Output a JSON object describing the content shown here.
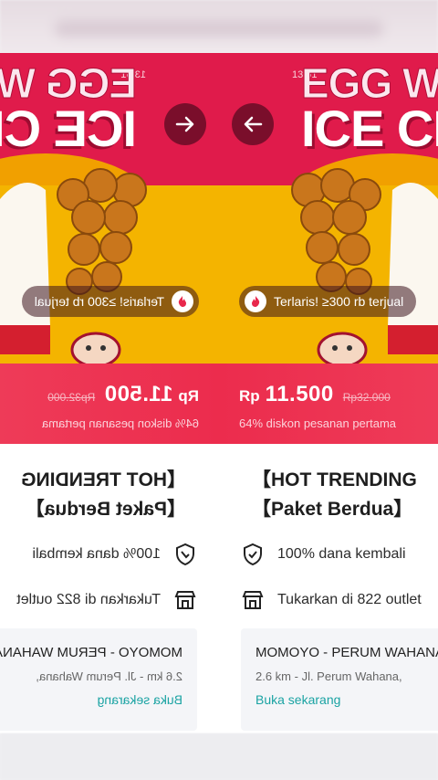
{
  "status": {
    "time": "13:51"
  },
  "hero": {
    "title_line1": "EGG WA",
    "title_line2": "ICE CR",
    "badge": "Terlaris! ≥300 rb terjual"
  },
  "price": {
    "currency": "Rp",
    "amount": "11.500",
    "original": "Rp32.000",
    "discount": "64% diskon pesanan pertama"
  },
  "product": {
    "title_line1": "【HOT TRENDING",
    "title_line2": "【Paket Berdua】",
    "feature1": "100% dana kembali",
    "feature2": "Tukarkan di 822 outlet"
  },
  "store": {
    "name": "MOMOYO - PERUM WAHANA",
    "address": "2.6 km - Jl. Perum Wahana,",
    "action": "Buka sekarang"
  },
  "nav": {
    "prev_icon": "arrow-left-icon",
    "next_icon": "arrow-right-icon"
  },
  "colors": {
    "primary": "#e01b4b",
    "price_band": "#ec2c4d",
    "accent_teal": "#1aa3a3",
    "dark_button": "#7a0e2b"
  }
}
